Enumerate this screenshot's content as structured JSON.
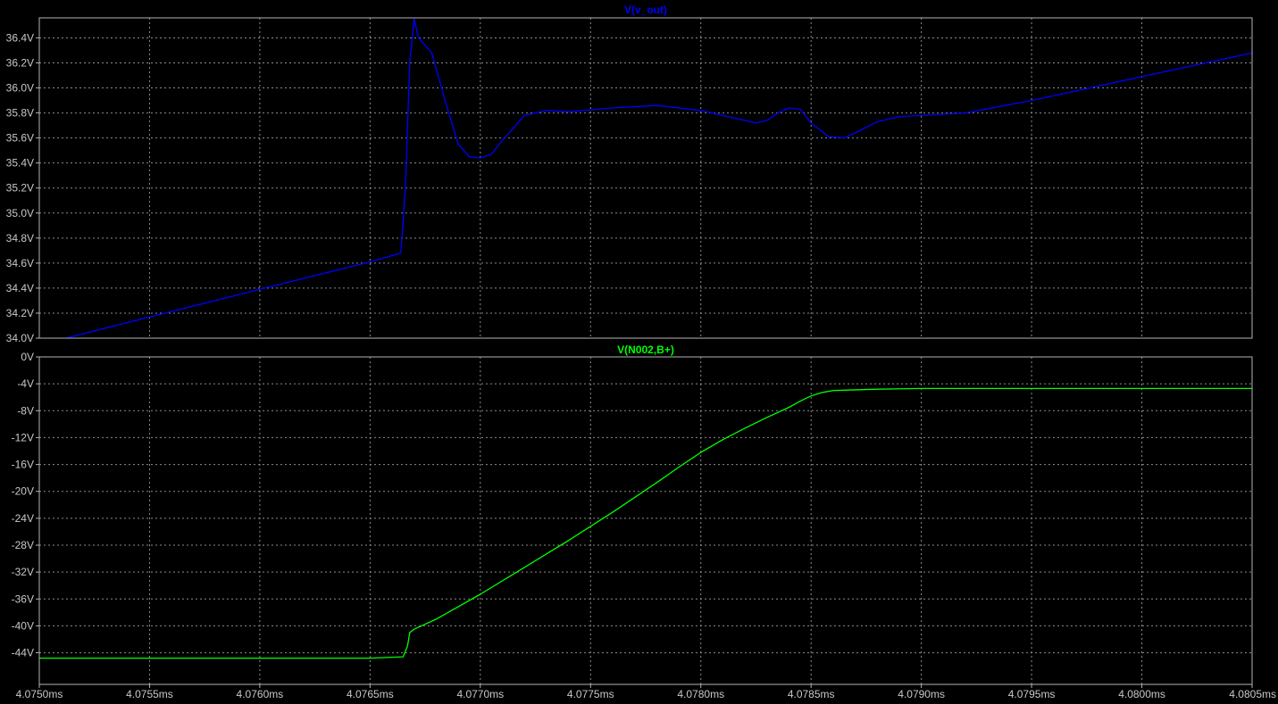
{
  "chart_data": [
    {
      "type": "line",
      "title": "V(v_out)",
      "color": "#0000ff",
      "ylim": [
        34.0,
        36.5
      ],
      "y_ticks": [
        34.0,
        34.2,
        34.4,
        34.6,
        34.8,
        35.0,
        35.2,
        35.4,
        35.6,
        35.8,
        36.0,
        36.2,
        36.4
      ],
      "y_tick_labels": [
        "34.0V",
        "34.2V",
        "34.4V",
        "34.6V",
        "34.8V",
        "35.0V",
        "35.2V",
        "35.4V",
        "35.6V",
        "35.8V",
        "36.0V",
        "36.2V",
        "36.4V"
      ],
      "grid": true,
      "series": [
        {
          "x": [
            4.07512,
            4.0755,
            4.076,
            4.0765,
            4.07664,
            4.07666,
            4.07668,
            4.0767,
            4.07672,
            4.07678,
            4.07684,
            4.0769,
            4.07695,
            4.077,
            4.07705,
            4.0771,
            4.0772,
            4.0773,
            4.0774,
            4.0776,
            4.0778,
            4.078,
            4.0782,
            4.07825,
            4.0783,
            4.07835,
            4.0784,
            4.07845,
            4.0785,
            4.07858,
            4.07865,
            4.0787,
            4.0788,
            4.0789,
            4.079,
            4.0792,
            4.0795,
            4.08,
            4.0805
          ],
          "y": [
            34.0,
            34.17,
            34.39,
            34.61,
            34.68,
            35.2,
            36.2,
            36.55,
            36.4,
            36.28,
            35.9,
            35.55,
            35.45,
            35.44,
            35.47,
            35.58,
            35.78,
            35.82,
            35.81,
            35.84,
            35.86,
            35.82,
            35.74,
            35.72,
            35.74,
            35.8,
            35.84,
            35.83,
            35.72,
            35.61,
            35.6,
            35.64,
            35.73,
            35.77,
            35.78,
            35.8,
            35.9,
            36.09,
            36.28
          ]
        }
      ]
    },
    {
      "type": "line",
      "title": "V(N002,B+)",
      "color": "#00ff00",
      "ylim": [
        -47,
        0
      ],
      "y_ticks": [
        0,
        -4,
        -8,
        -12,
        -16,
        -20,
        -24,
        -28,
        -32,
        -36,
        -40,
        -44
      ],
      "y_tick_labels": [
        "0V",
        "-4V",
        "-8V",
        "-12V",
        "-16V",
        "-20V",
        "-24V",
        "-28V",
        "-32V",
        "-36V",
        "-40V",
        "-44V"
      ],
      "grid": true,
      "series": [
        {
          "x": [
            4.075,
            4.0755,
            4.076,
            4.0765,
            4.07665,
            4.07667,
            4.07668,
            4.0767,
            4.0768,
            4.077,
            4.0772,
            4.0774,
            4.0776,
            4.0778,
            4.0779,
            4.078,
            4.0781,
            4.0782,
            4.0783,
            4.0784,
            4.07845,
            4.0785,
            4.07855,
            4.0786,
            4.0788,
            4.079,
            4.0795,
            4.08,
            4.0805
          ],
          "y": [
            -44.8,
            -44.8,
            -44.8,
            -44.8,
            -44.6,
            -43.0,
            -41.0,
            -40.5,
            -39.0,
            -35.3,
            -31.3,
            -27.3,
            -23.1,
            -18.7,
            -16.4,
            -14.2,
            -12.3,
            -10.6,
            -9.0,
            -7.5,
            -6.6,
            -5.8,
            -5.3,
            -5.0,
            -4.8,
            -4.7,
            -4.7,
            -4.7,
            -4.7
          ]
        }
      ]
    }
  ],
  "x_axis": {
    "xlim": [
      4.075,
      4.0805
    ],
    "ticks": [
      4.075,
      4.0755,
      4.076,
      4.0765,
      4.077,
      4.0775,
      4.078,
      4.0785,
      4.079,
      4.0795,
      4.08,
      4.0805
    ],
    "tick_labels": [
      "4.0750ms",
      "4.0755ms",
      "4.0760ms",
      "4.0765ms",
      "4.0770ms",
      "4.0775ms",
      "4.0780ms",
      "4.0785ms",
      "4.0790ms",
      "4.0795ms",
      "4.0800ms",
      "4.0805ms"
    ]
  },
  "colors": {
    "background": "#000000",
    "frame": "#b4b4b4",
    "grid": "#8c8c8c",
    "tick_text": "#c8c8c8"
  }
}
